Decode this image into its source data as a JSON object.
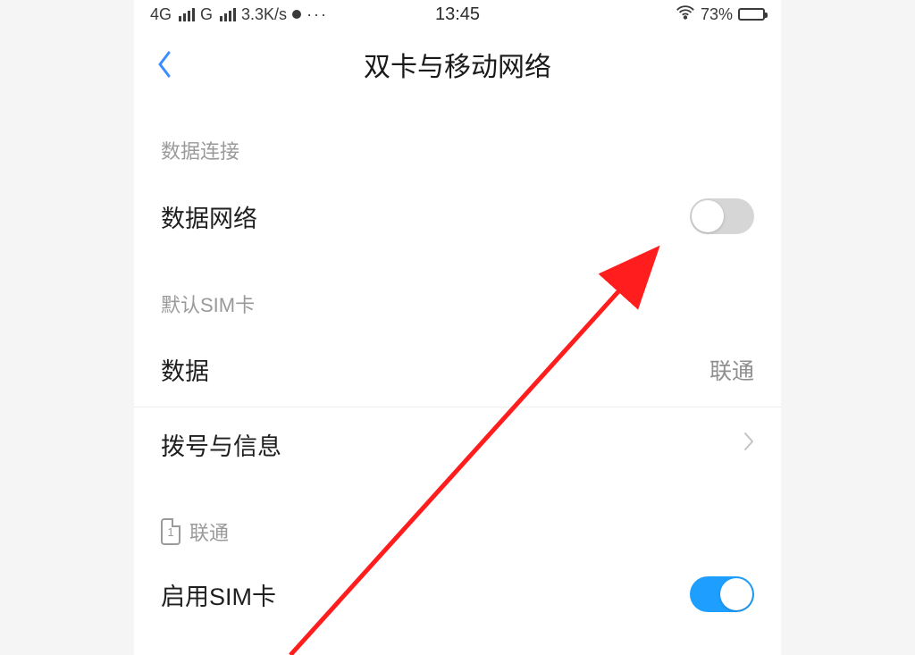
{
  "status_bar": {
    "net1_label": "4G",
    "net2_label": "G",
    "speed": "3.3K/s",
    "time": "13:45",
    "battery_pct": "73%"
  },
  "header": {
    "title": "双卡与移动网络"
  },
  "section1": {
    "header": "数据连接",
    "data_network_label": "数据网络",
    "data_network_on": false
  },
  "section2": {
    "header": "默认SIM卡",
    "data_label": "数据",
    "data_value": "联通",
    "dial_label": "拨号与信息"
  },
  "section3": {
    "sim_slot": "1",
    "sim_carrier": "联通",
    "enable_label": "启用SIM卡",
    "enable_on": true
  }
}
